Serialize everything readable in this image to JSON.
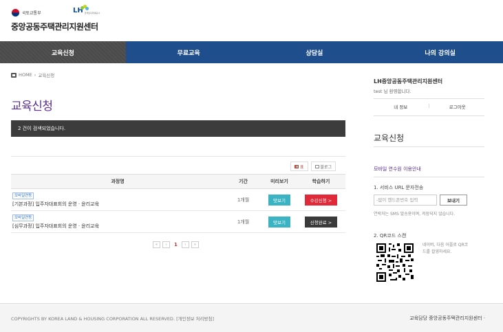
{
  "header": {
    "ministry_name": "국토교통부",
    "lh_logo": "LH",
    "lh_sub": "한국토지주택공사",
    "site_title": "중앙공동주택관리지원센터"
  },
  "nav": {
    "items": [
      {
        "label": "교육신청",
        "active": true
      },
      {
        "label": "무료교육",
        "active": false
      },
      {
        "label": "상담실",
        "active": false
      },
      {
        "label": "나의 강의실",
        "active": false
      }
    ]
  },
  "breadcrumb": {
    "home": "HOME",
    "separator": "›",
    "current": "교육신청",
    "icon": "home-icon"
  },
  "page": {
    "title": "교육신청",
    "result_text": "2 건이 검색되었습니다."
  },
  "view_toggle": {
    "table_label": "표",
    "blog_label": "블로그"
  },
  "table": {
    "headers": {
      "name": "과정명",
      "period": "기간",
      "preview": "미리보기",
      "study": "학습하기"
    },
    "rows": [
      {
        "badge": "모바일연동",
        "name": "[기본과정] 입주자대표회의 운영 · 윤리교육",
        "period": "1개월",
        "preview": "맛보기",
        "action": "수강신청 >",
        "action_type": "apply"
      },
      {
        "badge": "모바일연동",
        "name": "[심무과정] 입주자대표회의 운영 · 윤리교육",
        "period": "1개월",
        "preview": "맛보기",
        "action": "신청완료 >",
        "action_type": "closed"
      }
    ]
  },
  "pagination": {
    "first": "«",
    "prev": "‹",
    "current": "1",
    "next": "›",
    "last": "»"
  },
  "sidebar": {
    "org_name": "LH중앙공동주택관리지원센터",
    "greeting": "test 님 환영합니다.",
    "my_info": "내 정보",
    "separator": "|",
    "logout": "로그아웃",
    "section_title": "교육신청",
    "mobile_guide": "모바일 연수원 이용안내",
    "sms_title": "1. 서비스 URL 문자전송",
    "sms_placeholder": "-없이 핸드폰번호 입력",
    "sms_button": "보내기",
    "sms_note": "연락처는 SMS 발송용이며, 저장되지 않습니다.",
    "qr_title": "2. QR코드 스캔",
    "qr_note": "네이버, 다음 어플로 QR코드를 촬영하세요."
  },
  "footer": {
    "copyright": "COPYRIGHTS BY KOREA LAND & HOUSING CORPORATION ALL RESERVED. [개인정보 처리방침]",
    "right_text": "교육담당 중앙공동주택관리지원센터 ·"
  },
  "colors": {
    "nav_bg": "#1f4e8c",
    "nav_active": "#4a4a4a",
    "title_purple": "#5a2d91",
    "apply_red": "#e02a3a",
    "preview_teal": "#3bb3c3"
  }
}
